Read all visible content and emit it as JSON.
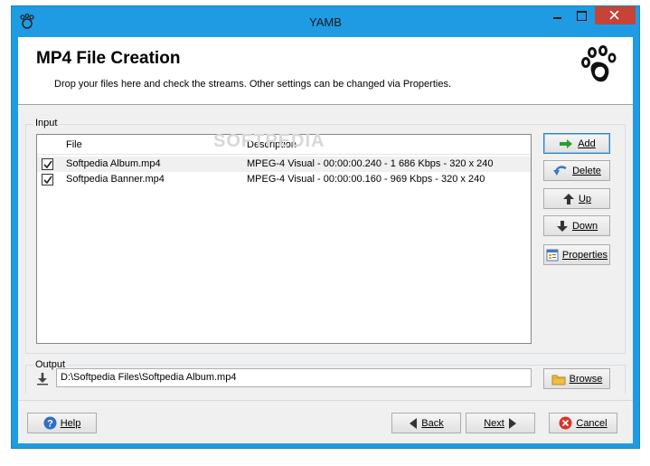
{
  "window": {
    "title": "YAMB",
    "accent": "#1e9be2",
    "close_color": "#c74336"
  },
  "header": {
    "title": "MP4 File Creation",
    "subtitle": "Drop your files here and check the streams. Other settings can be changed via Properties."
  },
  "input": {
    "group_label": "Input",
    "columns": [
      "File",
      "Description"
    ],
    "rows": [
      {
        "checked": true,
        "file": "Softpedia Album.mp4",
        "description": "MPEG-4 Visual - 00:00:00.240 - 1 686 Kbps - 320 x 240"
      },
      {
        "checked": true,
        "file": "Softpedia Banner.mp4",
        "description": "MPEG-4 Visual - 00:00:00.160 - 969 Kbps - 320 x 240"
      }
    ],
    "watermark": "SOFTPEDIA"
  },
  "side_buttons": {
    "add": {
      "label": "Add",
      "icon": "plus-arrow-icon"
    },
    "delete": {
      "label": "Delete",
      "icon": "delete-arrow-icon"
    },
    "up": {
      "label": "Up",
      "icon": "arrow-up-icon"
    },
    "down": {
      "label": "Down",
      "icon": "arrow-down-icon"
    },
    "properties": {
      "label": "Properties",
      "icon": "properties-icon"
    }
  },
  "output": {
    "group_label": "Output",
    "path": "D:\\Softpedia Files\\Softpedia Album.mp4",
    "browse_label": "Browse",
    "icon": "download-arrow-icon"
  },
  "footer": {
    "help_label": "Help",
    "back_label": "Back",
    "next_label": "Next",
    "cancel_label": "Cancel"
  }
}
